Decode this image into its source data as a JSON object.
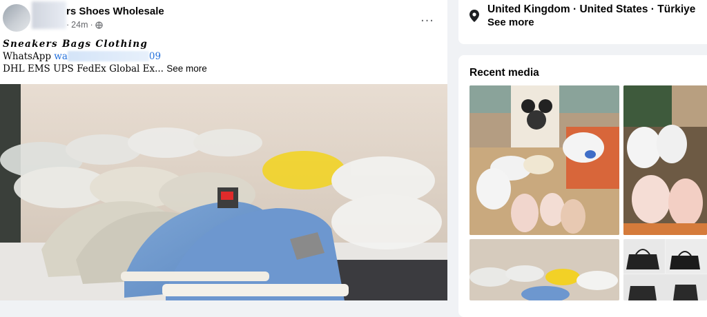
{
  "post": {
    "page_name": "rs Shoes Wholesale",
    "timestamp": "24m",
    "separator": "·",
    "more_icon": "...",
    "text_line1": "Sneakers Bags Clothing",
    "whatsapp_label": "WhatsApp ",
    "whatsapp_prefix": "wa",
    "whatsapp_suffix": "09",
    "text_line3": "DHL EMS UPS FedEx Global Ex...",
    "see_more": "See more"
  },
  "intro": {
    "location_icon": "map-pin-icon",
    "location": "United Kingdom · United States · Türkiye",
    "see_more": "See more"
  },
  "recent_media": {
    "title": "Recent media"
  },
  "colors": {
    "link": "#216fdb",
    "background": "#f0f2f5",
    "card": "#ffffff",
    "muted": "#65676b"
  }
}
